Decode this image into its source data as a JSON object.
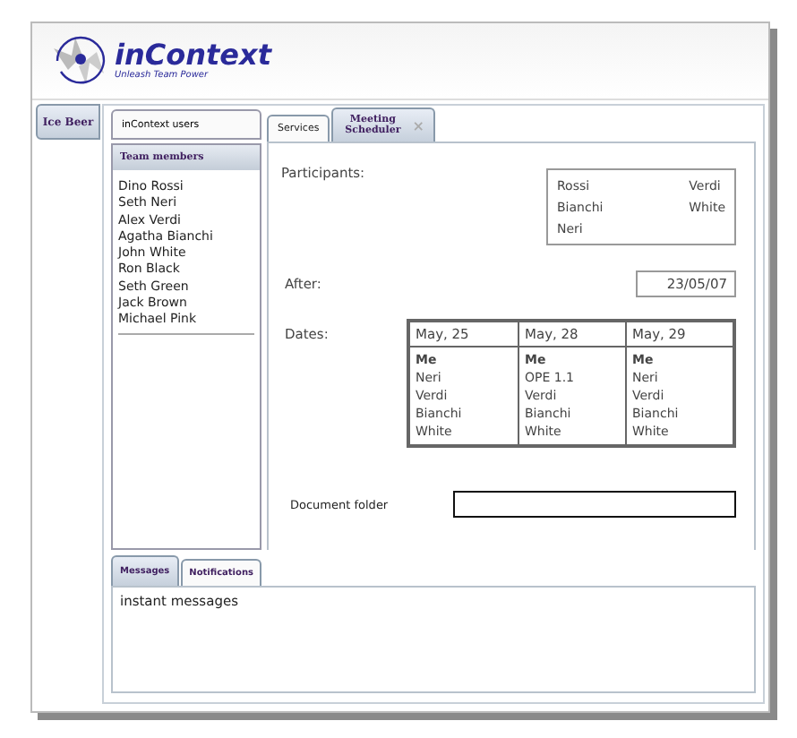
{
  "header": {
    "logo_title": "inContext",
    "logo_tagline": "Unleash Team Power"
  },
  "side_tabs": [
    {
      "label": "Ice Beer",
      "selected": true
    }
  ],
  "users_panel": {
    "title": "inContext users",
    "list_header": "Team members",
    "members": [
      "Dino Rossi",
      "Seth Neri",
      "Alex Verdi",
      "Agatha Bianchi",
      "John White",
      "Ron Black",
      "Seth Green",
      "Jack Brown",
      "Michael Pink"
    ]
  },
  "tabs": [
    {
      "label": "Services",
      "selected": false,
      "closable": false
    },
    {
      "label": "Meeting Scheduler",
      "selected": true,
      "closable": true,
      "close_glyph": "×"
    }
  ],
  "scheduler": {
    "participants_label": "Participants:",
    "participants": [
      "Rossi",
      "Verdi",
      "Bianchi",
      "White",
      "Neri"
    ],
    "after_label": "After:",
    "after_value": "23/05/07",
    "dates_label": "Dates:",
    "dates": [
      {
        "date": "May, 25",
        "people": [
          {
            "name": "Me",
            "emphasized": true
          },
          {
            "name": "Neri",
            "emphasized": false
          },
          {
            "name": "Verdi",
            "emphasized": false
          },
          {
            "name": "Bianchi",
            "emphasized": false
          },
          {
            "name": "White",
            "emphasized": false
          }
        ]
      },
      {
        "date": "May, 28",
        "people": [
          {
            "name": "Me",
            "emphasized": true
          },
          {
            "name": "OPE 1.1",
            "emphasized": false
          },
          {
            "name": "Verdi",
            "emphasized": false
          },
          {
            "name": "Bianchi",
            "emphasized": false
          },
          {
            "name": "White",
            "emphasized": false
          }
        ]
      },
      {
        "date": "May, 29",
        "people": [
          {
            "name": "Me",
            "emphasized": true
          },
          {
            "name": "Neri",
            "emphasized": false
          },
          {
            "name": "Verdi",
            "emphasized": false
          },
          {
            "name": "Bianchi",
            "emphasized": false
          },
          {
            "name": "White",
            "emphasized": false
          }
        ]
      }
    ],
    "folder_label": "Document folder"
  },
  "message_tabs": [
    {
      "label": "Messages",
      "selected": true
    },
    {
      "label": "Notifications",
      "selected": false
    }
  ],
  "messages": {
    "text": "instant messages"
  }
}
